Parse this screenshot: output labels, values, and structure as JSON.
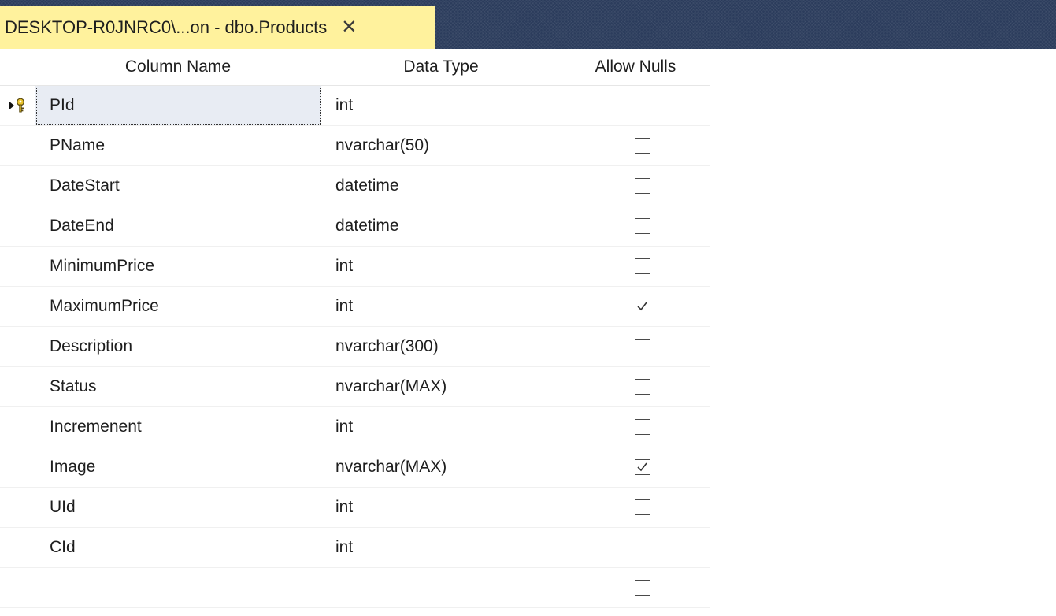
{
  "tab": {
    "title": "DESKTOP-R0JNRC0\\...on - dbo.Products",
    "close_glyph": "✕"
  },
  "columns": {
    "name": "Column Name",
    "type": "Data Type",
    "nulls": "Allow Nulls"
  },
  "rows": [
    {
      "name": "PId",
      "type": "int",
      "allow_nulls": false,
      "primary_key": true
    },
    {
      "name": "PName",
      "type": "nvarchar(50)",
      "allow_nulls": false
    },
    {
      "name": "DateStart",
      "type": "datetime",
      "allow_nulls": false
    },
    {
      "name": "DateEnd",
      "type": "datetime",
      "allow_nulls": false
    },
    {
      "name": "MinimumPrice",
      "type": "int",
      "allow_nulls": false
    },
    {
      "name": "MaximumPrice",
      "type": "int",
      "allow_nulls": true
    },
    {
      "name": "Description",
      "type": "nvarchar(300)",
      "allow_nulls": false
    },
    {
      "name": "Status",
      "type": "nvarchar(MAX)",
      "allow_nulls": false
    },
    {
      "name": "Incremenent",
      "type": "int",
      "allow_nulls": false
    },
    {
      "name": "Image",
      "type": "nvarchar(MAX)",
      "allow_nulls": true
    },
    {
      "name": "UId",
      "type": "int",
      "allow_nulls": false
    },
    {
      "name": "CId",
      "type": "int",
      "allow_nulls": false
    },
    {
      "name": "",
      "type": "",
      "allow_nulls": false
    }
  ],
  "icons": {
    "row_indicator": "current-row-arrow-icon",
    "primary_key": "key-icon"
  }
}
